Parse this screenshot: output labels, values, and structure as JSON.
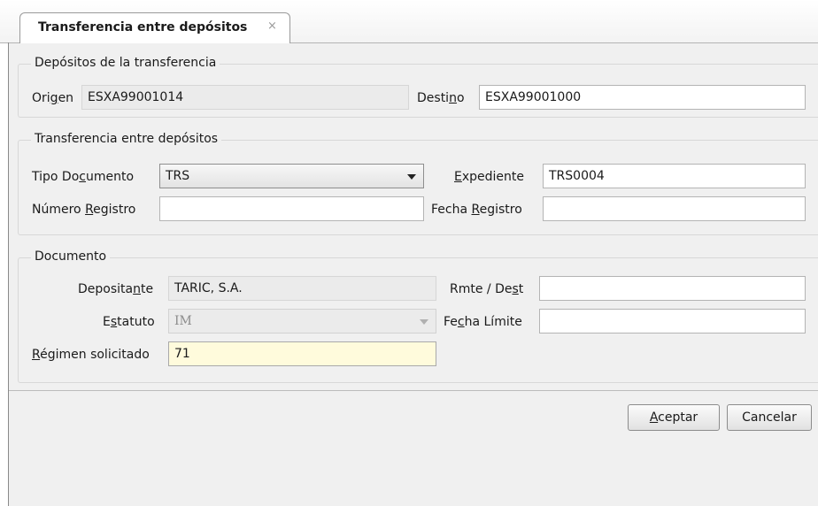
{
  "tab": {
    "title": "Transferencia entre depósitos",
    "close_glyph": "×"
  },
  "group1": {
    "title": "Depósitos de la transferencia",
    "origen_label_pre": "Ori",
    "origen_label_u": "g",
    "origen_label_post": "en",
    "origen_value": "ESXA99001014",
    "destino_label_pre": "Desti",
    "destino_label_u": "n",
    "destino_label_post": "o",
    "destino_value": "ESXA99001000"
  },
  "group2": {
    "title": "Transferencia entre depósitos",
    "tipo_label_pre": "Tipo Do",
    "tipo_label_u": "c",
    "tipo_label_post": "umento",
    "tipo_value": "TRS",
    "expediente_label_pre": "",
    "expediente_label_u": "E",
    "expediente_label_post": "xpediente",
    "expediente_value": "TRS0004",
    "numreg_label_pre": "Número ",
    "numreg_label_u": "R",
    "numreg_label_post": "egistro",
    "numreg_value": "",
    "fechareg_label_pre": "Fecha ",
    "fechareg_label_u": "R",
    "fechareg_label_post": "egistro",
    "fechareg_value": ""
  },
  "group3": {
    "title": "Documento",
    "depositante_label_pre": "Deposita",
    "depositante_label_u": "n",
    "depositante_label_post": "te",
    "depositante_value": "TARIC, S.A.",
    "rmte_label_pre": "Rmte / De",
    "rmte_label_u": "s",
    "rmte_label_post": "t",
    "rmte_value": "",
    "estatuto_label_pre": "E",
    "estatuto_label_u": "s",
    "estatuto_label_post": "tatuto",
    "estatuto_value": "IM",
    "fechalim_label_pre": "Fe",
    "fechalim_label_u": "c",
    "fechalim_label_post": "ha Límite",
    "fechalim_value": "",
    "regimen_label_pre": "",
    "regimen_label_u": "R",
    "regimen_label_post": "égimen solicitado",
    "regimen_value": "71"
  },
  "buttons": {
    "aceptar_pre": "",
    "aceptar_u": "A",
    "aceptar_post": "ceptar",
    "cancelar": "Cancelar"
  },
  "colors": {
    "background": "#f0f0f0",
    "highlight_field": "#fffbdc"
  },
  "icons": {
    "tab_close": "close-icon",
    "dropdown": "chevron-down-icon"
  }
}
